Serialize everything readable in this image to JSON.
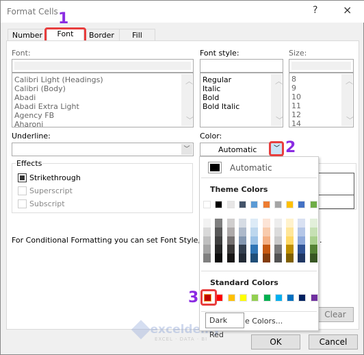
{
  "window": {
    "title": "Format Cells",
    "help": "?",
    "close": "×"
  },
  "tabs": [
    {
      "label": "Number"
    },
    {
      "label": "Font",
      "active": true
    },
    {
      "label": "Border"
    },
    {
      "label": "Fill"
    }
  ],
  "font": {
    "label": "Font:",
    "value": "",
    "items": [
      "Calibri Light (Headings)",
      "Calibri (Body)",
      "Abadi",
      "Abadi Extra Light",
      "Agency FB",
      "Aharoni"
    ]
  },
  "font_style": {
    "label": "Font style:",
    "value": "",
    "items": [
      "Regular",
      "Italic",
      "Bold",
      "Bold Italic"
    ]
  },
  "size": {
    "label": "Size:",
    "value": "",
    "items": [
      "8",
      "9",
      "10",
      "11",
      "12",
      "14"
    ]
  },
  "underline": {
    "label": "Underline:",
    "value": ""
  },
  "color": {
    "label": "Color:",
    "value": "Automatic"
  },
  "effects": {
    "label": "Effects",
    "strikethrough": {
      "label": "Strikethrough",
      "checked": true
    },
    "superscript": {
      "label": "Superscript",
      "checked": false
    },
    "subscript": {
      "label": "Subscript",
      "checked": false
    }
  },
  "info_text": "For Conditional Formatting you can set Font Style, Un",
  "info_tail": ".",
  "color_menu": {
    "automatic": "Automatic",
    "theme_header": "Theme Colors",
    "theme_colors": [
      "#FFFFFF",
      "#000000",
      "#E7E6E6",
      "#44546A",
      "#5B9BD5",
      "#ED7D31",
      "#A5A5A5",
      "#FFC000",
      "#4472C4",
      "#70AD47"
    ],
    "theme_shades": [
      [
        "#F2F2F2",
        "#D9D9D9",
        "#BFBFBF",
        "#A6A6A6",
        "#808080"
      ],
      [
        "#808080",
        "#595959",
        "#404040",
        "#262626",
        "#0D0D0D"
      ],
      [
        "#D0CECE",
        "#AEAAAA",
        "#757171",
        "#3A3838",
        "#171616"
      ],
      [
        "#D6DCE4",
        "#ADB9CA",
        "#8497B0",
        "#333F4F",
        "#222A35"
      ],
      [
        "#DDEBF7",
        "#BDD7EE",
        "#9BC2E6",
        "#2F75B5",
        "#1F4E78"
      ],
      [
        "#FCE4D6",
        "#F8CBAD",
        "#F4B084",
        "#C65911",
        "#833C0C"
      ],
      [
        "#EDEDED",
        "#DBDBDB",
        "#C9C9C9",
        "#7B7B7B",
        "#525252"
      ],
      [
        "#FFF2CC",
        "#FFE699",
        "#FFD966",
        "#BF8F00",
        "#806000"
      ],
      [
        "#D9E1F2",
        "#B4C6E7",
        "#8EA9DB",
        "#305496",
        "#203764"
      ],
      [
        "#E2EFDA",
        "#C6E0B4",
        "#A9D08E",
        "#548235",
        "#375623"
      ]
    ],
    "standard_header": "Standard Colors",
    "standard_colors": [
      "#C00000",
      "#FF0000",
      "#FFC000",
      "#FFFF00",
      "#92D050",
      "#00B050",
      "#00B0F0",
      "#0070C0",
      "#002060",
      "#7030A0"
    ],
    "more_colors_tail": "e Colors...",
    "tooltip": "Dark Red"
  },
  "buttons": {
    "clear": "Clear",
    "ok": "OK",
    "cancel": "Cancel"
  },
  "annotations": [
    "1",
    "2",
    "3"
  ],
  "watermark": {
    "name": "exceldemy",
    "tagline": "EXCEL · DATA · BI"
  }
}
